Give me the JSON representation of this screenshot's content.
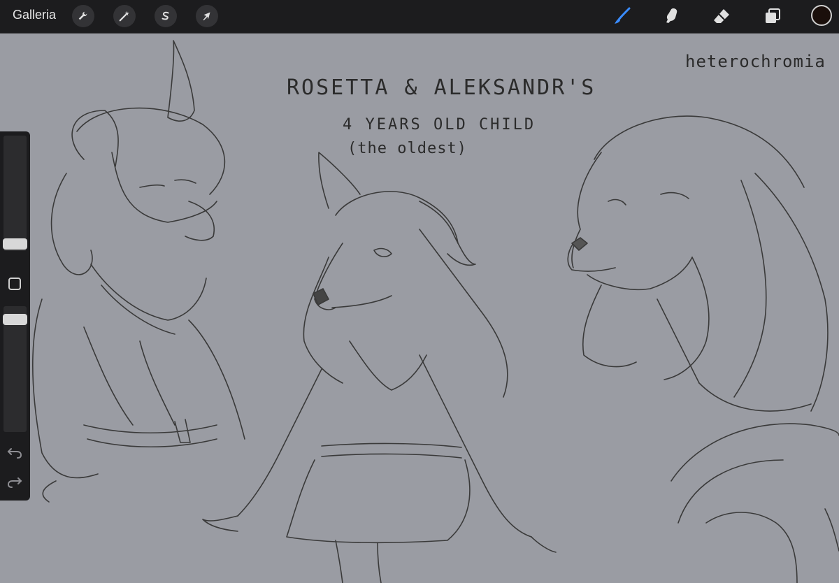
{
  "toolbar": {
    "gallery_label": "Galleria",
    "left_tools": [
      {
        "name": "actions",
        "icon": "wrench-icon"
      },
      {
        "name": "adjustments",
        "icon": "magic-wand-icon"
      },
      {
        "name": "selection",
        "icon": "selection-s-icon"
      },
      {
        "name": "transform",
        "icon": "arrow-cursor-icon"
      }
    ],
    "right_tools": [
      {
        "name": "brush",
        "icon": "brush-icon",
        "active": true
      },
      {
        "name": "smudge",
        "icon": "smudge-finger-icon"
      },
      {
        "name": "eraser",
        "icon": "eraser-icon"
      },
      {
        "name": "layers",
        "icon": "layers-icon"
      }
    ],
    "current_color": "#1a0f0b",
    "active_color": "#3a8cff"
  },
  "sidebar": {
    "icons": [
      "modifier-square-icon",
      "undo-icon",
      "redo-icon"
    ]
  },
  "canvas": {
    "background": "#9a9ca3",
    "notes": {
      "title": "ROSETTA & ALEKSANDR'S",
      "line2": "4 YEARS OLD CHILD",
      "line3": "(the oldest)",
      "corner": "heterochromia"
    }
  }
}
